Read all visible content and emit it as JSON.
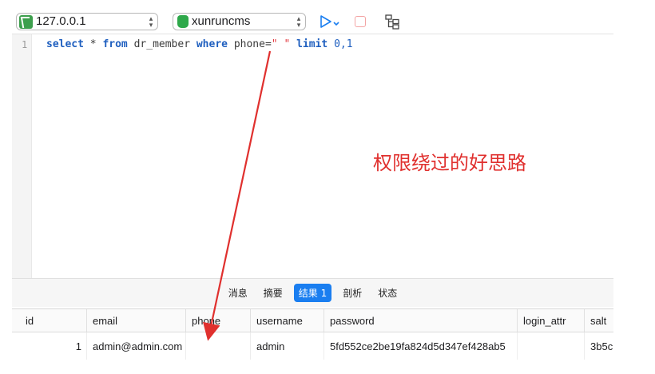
{
  "toolbar": {
    "connection": "127.0.0.1",
    "database": "xunruncms",
    "run_icon": "run-icon",
    "stop_icon": "stop-icon",
    "structure_icon": "structure-icon"
  },
  "editor": {
    "line_number": "1",
    "sql": {
      "kw_select": "select",
      "star": " * ",
      "kw_from": "from",
      "table": " dr_member ",
      "kw_where": "where",
      "field": " phone=",
      "value": "\" \"",
      "kw_limit": " limit ",
      "limit_args": "0,1"
    }
  },
  "annotation": "权限绕过的好思路",
  "tabs": [
    {
      "label": "消息",
      "active": false
    },
    {
      "label": "摘要",
      "active": false
    },
    {
      "label": "结果 1",
      "active": true
    },
    {
      "label": "剖析",
      "active": false
    },
    {
      "label": "状态",
      "active": false
    }
  ],
  "results": {
    "columns": [
      "id",
      "email",
      "phone",
      "username",
      "password",
      "login_attr",
      "salt"
    ],
    "rows": [
      {
        "id": "1",
        "email": "admin@admin.com",
        "phone": "",
        "username": "admin",
        "password": "5fd552ce2be19fa824d5d347ef428ab5",
        "login_attr": "",
        "salt": "3b5c"
      }
    ]
  },
  "colors": {
    "accent": "#1a7ef0",
    "annotation_red": "#e0302e",
    "sql_keyword": "#1f5fbf",
    "sql_string": "#e2363d"
  }
}
